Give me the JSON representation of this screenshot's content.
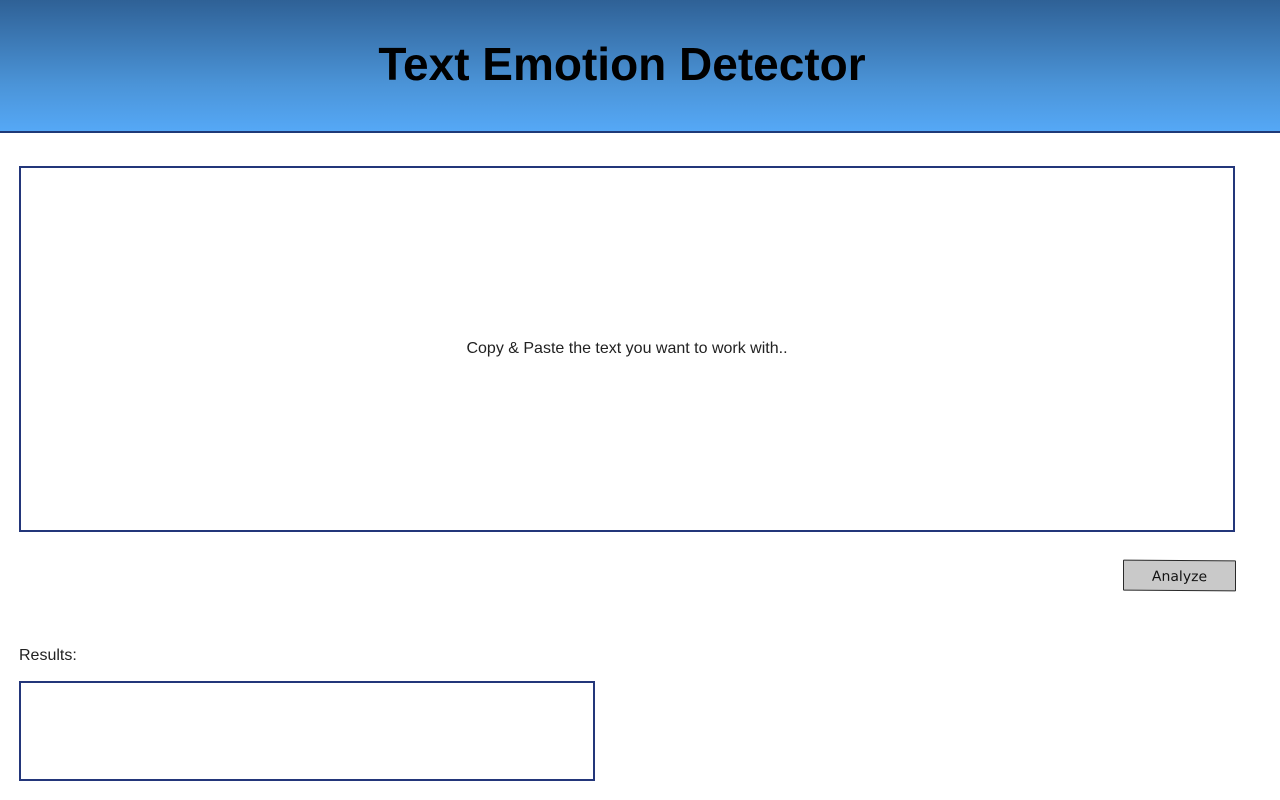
{
  "header": {
    "title": "Text Emotion Detector"
  },
  "input": {
    "placeholder": "Copy & Paste the text you want to work with.."
  },
  "actions": {
    "analyze_label": "Analyze"
  },
  "results": {
    "label": "Results:",
    "value": ""
  },
  "colors": {
    "header_gradient_top": "#2f6196",
    "header_gradient_bottom": "#55a8f6",
    "border_accent": "#23367a",
    "button_background": "#c9c9c9"
  }
}
